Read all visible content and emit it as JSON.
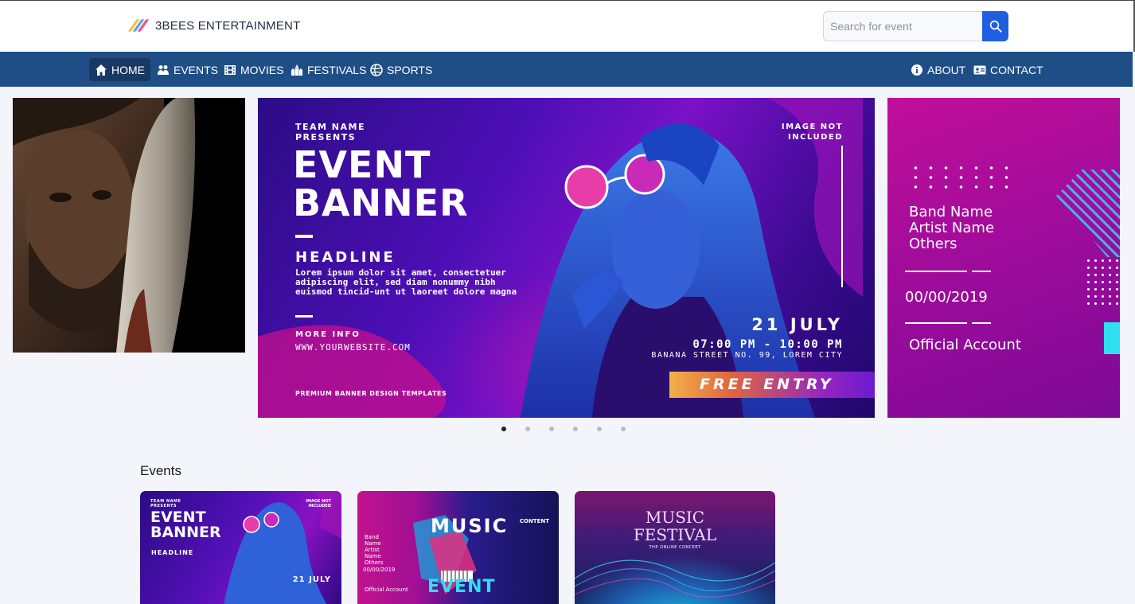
{
  "header": {
    "brand": "3BEES ENTERTAINMENT",
    "search_placeholder": "Search for event"
  },
  "nav": {
    "left": [
      {
        "label": "HOME",
        "icon": "home-icon"
      },
      {
        "label": "EVENTS",
        "icon": "people-icon"
      },
      {
        "label": "MOVIES",
        "icon": "film-icon"
      },
      {
        "label": "FESTIVALS",
        "icon": "festival-icon"
      },
      {
        "label": "SPORTS",
        "icon": "ball-icon"
      }
    ],
    "right": [
      {
        "label": "ABOUT",
        "icon": "info-icon"
      },
      {
        "label": "CONTACT",
        "icon": "contact-card-icon"
      }
    ],
    "active": "HOME"
  },
  "carousel": {
    "dot_count": 6,
    "active_dot": 0,
    "main": {
      "team": "TEAM NAME PRESENTS",
      "title": "EVENT BANNER",
      "headline": "HEADLINE",
      "lorem": "Lorem ipsum dolor sit amet, consectetuer adipiscing elit, sed diam nonummy nibh euismod tincid-unt ut laoreet dolore magna",
      "more_info": "MORE INFO",
      "website": "WWW.YOURWEBSITE.COM",
      "premium": "PREMIUM BANNER DESIGN TEMPLATES",
      "image_not": "IMAGE NOT INCLUDED",
      "date": "21 JULY",
      "time": "07:00 PM - 10:00 PM",
      "street": "BANANA STREET NO. 99, LOREM CITY",
      "entry": "FREE ENTRY"
    },
    "right": {
      "band": "Band Name",
      "artist": "Artist Name",
      "others": "Others",
      "date": "00/00/2019",
      "official": "Official Account"
    }
  },
  "events": {
    "title": "Events",
    "cards": [
      {
        "team": "TEAM NAME PRESENTS",
        "title": "EVENT BANNER",
        "headline": "HEADLINE",
        "date": "21 JULY",
        "not_included": "IMAGE NOT INCLUDED"
      },
      {
        "band": "Band Name Artist Name Others",
        "date": "00/00/2019",
        "official": "Official Account",
        "music": "MUSIC",
        "event": "EVENT",
        "content": "CONTENT"
      },
      {
        "title": "MUSIC FESTIVAL",
        "sub": "THE ONLINE CONCERT"
      }
    ]
  },
  "colors": {
    "nav_bg": "#1f4e86",
    "nav_active": "#173963",
    "search_button": "#1e5fe0",
    "page_bg": "#f3f5fb"
  }
}
